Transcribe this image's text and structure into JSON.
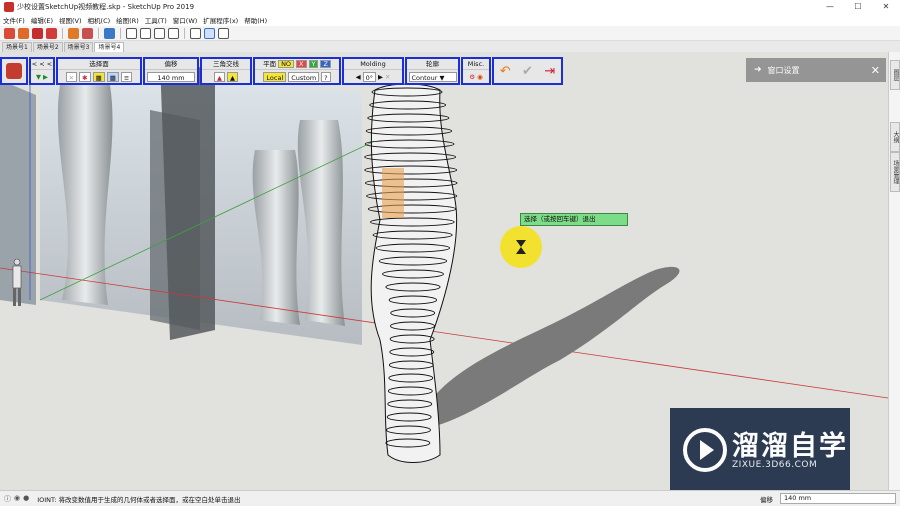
{
  "window": {
    "title": "少校设置SketchUp视频教程.skp - SketchUp Pro 2019",
    "controls": [
      "—",
      "☐",
      "✕"
    ]
  },
  "menu": [
    "文件(F)",
    "编辑(E)",
    "视图(V)",
    "相机(C)",
    "绘图(R)",
    "工具(T)",
    "窗口(W)",
    "扩展程序(x)",
    "帮助(H)"
  ],
  "scene_tabs": [
    "场景号1",
    "场景号2",
    "场景号3",
    "场景号4"
  ],
  "active_scene_tab": 3,
  "plugin": {
    "nav_label": "< < <",
    "nav_play": "▼ ▶",
    "select_label": "选择面",
    "offset_label": "偏移",
    "offset_value": "140 mm",
    "triangulate_label": "三角交线",
    "plane_label": "平面",
    "plane_no": "NO",
    "axis_x": "X",
    "axis_y": "Y",
    "axis_z": "Z",
    "local_label": "Local",
    "custom_label": "Custom",
    "help_label": "?",
    "molding_label": "Molding",
    "molding_value": "0°",
    "contour_header": "轮廓",
    "contour_select": "Contour",
    "misc_label": "Misc.",
    "accent_color": "#1c2fd6"
  },
  "panel": {
    "title": "窗口设置",
    "close": "✕"
  },
  "right_tray_tabs": [
    "图层",
    "大纲",
    "场景管理"
  ],
  "tooltip": "选择（或按回车键）退出",
  "status": {
    "message": "IOINT: 将改变数值用于生成的几何体或者选择面，或在空白处单击退出",
    "measure_label": "偏移",
    "measure_value": "140 mm"
  },
  "watermark": {
    "brand": "溜溜自学",
    "domain": "ZIXUE.3D66.COM"
  }
}
